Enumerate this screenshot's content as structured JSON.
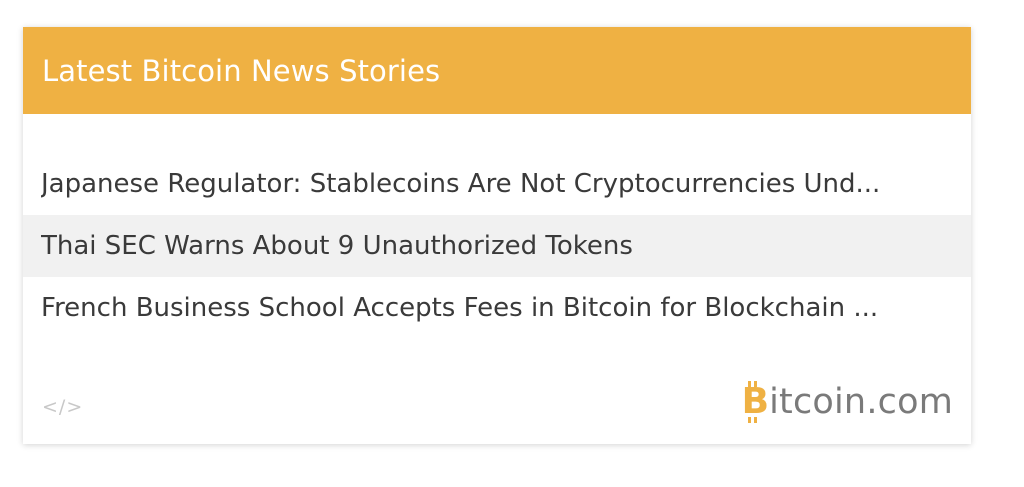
{
  "colors": {
    "header_bg": "#efb143",
    "brand_orange": "#efb143",
    "text": "#3a3a3a",
    "highlight_row": "#f1f1f1"
  },
  "widget": {
    "title": "Latest Bitcoin News Stories"
  },
  "news": {
    "items": [
      {
        "title": "Japanese Regulator: Stablecoins Are Not Cryptocurrencies Und...",
        "highlighted": false
      },
      {
        "title": "Thai SEC Warns About 9 Unauthorized Tokens",
        "highlighted": true
      },
      {
        "title": "French Business School Accepts Fees in Bitcoin for Blockchain ...",
        "highlighted": false
      }
    ]
  },
  "footer": {
    "embed_icon": "</>",
    "embed_icon_name": "code-embed-icon",
    "brand_first_letter": "B",
    "brand_rest": "itcoin.com"
  }
}
